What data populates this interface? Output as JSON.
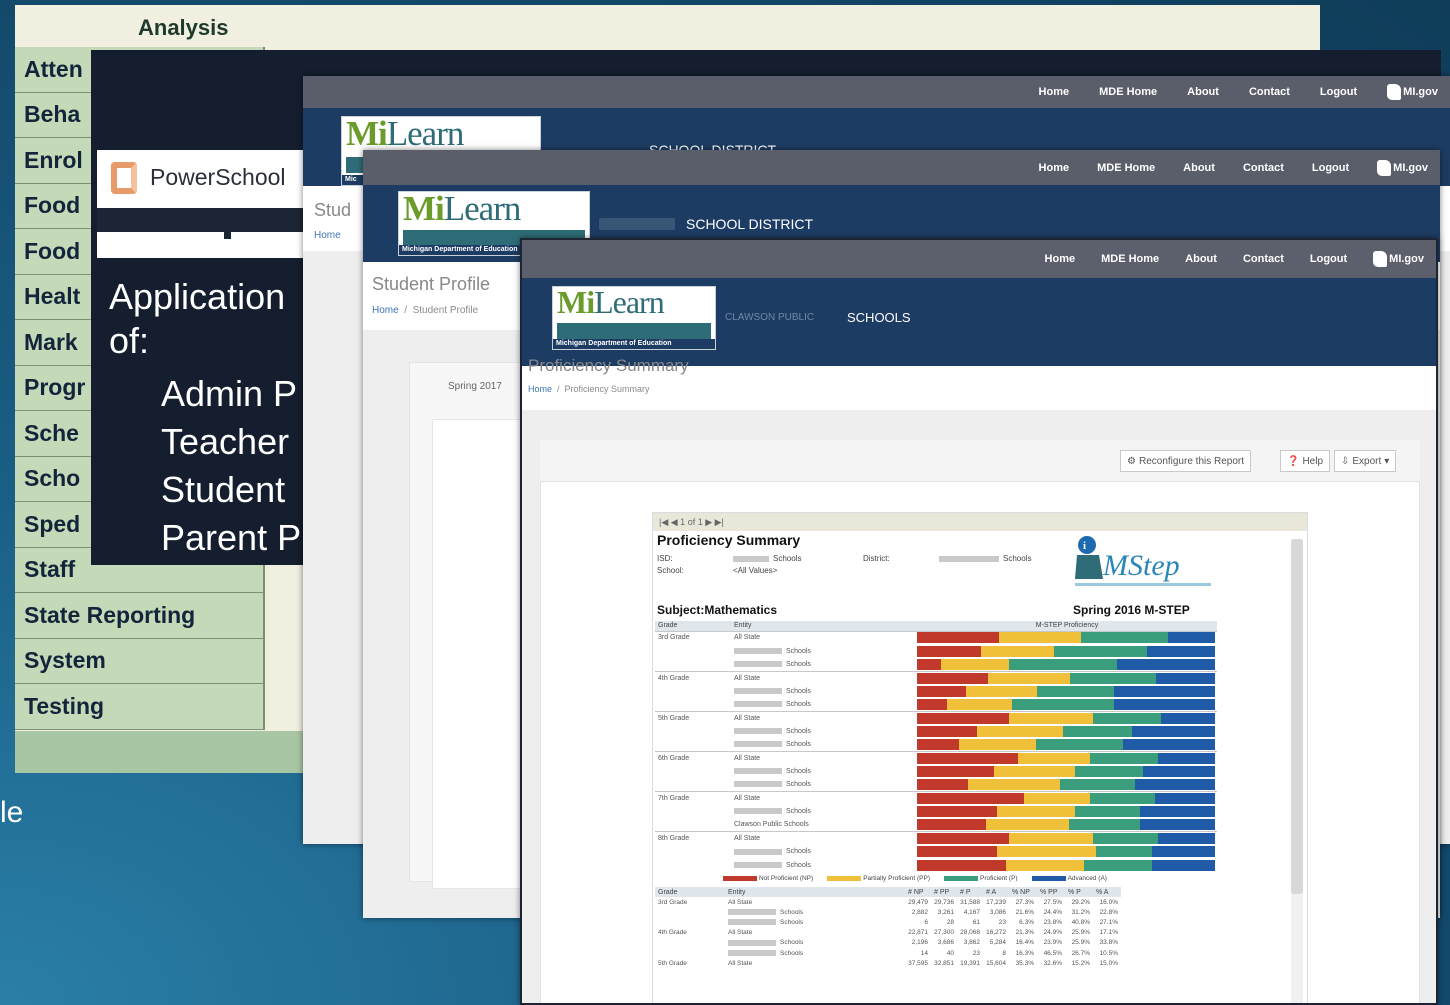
{
  "menu": {
    "title": "Analysis",
    "items": [
      "Atten",
      "Beha",
      "Enrol",
      "Food",
      "Food",
      "Healt",
      "Mark",
      "Progr",
      "Sche",
      "Scho",
      "Sped",
      "Staff",
      "State Reporting",
      "System",
      "Testing"
    ]
  },
  "background_text": "le",
  "powerschool": {
    "logo_text": "PowerSchool",
    "heading_line1": "Application",
    "heading_line2": "of:",
    "bullets": [
      "Admin P",
      "Teacher",
      "Student",
      "Parent P"
    ]
  },
  "nav": {
    "home": "Home",
    "mde_home": "MDE Home",
    "about": "About",
    "contact": "Contact",
    "logout": "Logout",
    "migov": "MI.gov"
  },
  "milearn": {
    "logo_prefix": "Mi",
    "logo_word": "Learn",
    "logo_footer": "Michigan Department of Education",
    "logo_footer_short": "Mic"
  },
  "win1": {
    "district": "SCHOOL DISTRICT",
    "page_title": "Stud",
    "breadcrumb_home": "Home"
  },
  "win2": {
    "district": "SCHOOL DISTRICT",
    "page_title": "Student Profile",
    "breadcrumb_home": "Home",
    "breadcrumb_current": "Student Profile",
    "tab_label": "Spring 2017"
  },
  "win3": {
    "district": "SCHOOLS",
    "district_prefix": "CLAWSON PUBLIC",
    "page_title": "Proficiency Summary",
    "breadcrumb_home": "Home",
    "breadcrumb_current": "Proficiency Summary",
    "toolbar": {
      "reconfigure": "Reconfigure this Report",
      "help": "Help",
      "export": "Export"
    }
  },
  "report": {
    "toolbar_text": "|◀  ◀  1  of 1  ▶  ▶|",
    "title": "Proficiency Summary",
    "isd_label": "ISD:",
    "isd_value": "Schools",
    "school_label": "School:",
    "school_value": "<All Values>",
    "district_label": "District:",
    "district_value": "Schools",
    "subject": "Subject:Mathematics",
    "assessment": "Spring 2016 M-STEP",
    "mstep_logo": "MStep",
    "table_headers": {
      "grade": "Grade",
      "entity": "Entity",
      "proficiency": "M-STEP Proficiency"
    },
    "legend": {
      "np": "Not Proficient (NP)",
      "pp": "Partially Proficient (PP)",
      "p": "Proficient (P)",
      "a": "Advanced (A)"
    },
    "num_headers": [
      "Grade",
      "Entity",
      "# NP",
      "# PP",
      "# P",
      "# A",
      "% NP",
      "% PP",
      "% P",
      "% A"
    ]
  },
  "chart_data": {
    "type": "bar",
    "title": "Proficiency Summary",
    "subtitle": "Subject:Mathematics — Spring 2016 M-STEP",
    "categories": [
      "3rd Grade – All State",
      "3rd Grade – Schools",
      "3rd Grade – Schools (Public)",
      "4th Grade – All State",
      "4th Grade – Schools",
      "4th Grade – Schools (Public)",
      "5th Grade – All State",
      "5th Grade – Schools",
      "5th Grade – Schools (Public)",
      "6th Grade – All State",
      "6th Grade – Schools",
      "6th Grade – Schools (Public)",
      "7th Grade – All State",
      "7th Grade – Schools",
      "7th Grade – Clawson Public Schools",
      "8th Grade – All State",
      "8th Grade – Schools",
      "8th Grade – Schools (Public)"
    ],
    "rows": [
      {
        "grade": "3rd Grade",
        "entity": "All State",
        "blur": false
      },
      {
        "grade": "",
        "entity": "Schools",
        "blur": true
      },
      {
        "grade": "",
        "entity": "Schools",
        "blur": true
      },
      {
        "grade": "4th Grade",
        "entity": "All State",
        "blur": false
      },
      {
        "grade": "",
        "entity": "Schools",
        "blur": true
      },
      {
        "grade": "",
        "entity": "Schools",
        "blur": true
      },
      {
        "grade": "5th Grade",
        "entity": "All State",
        "blur": false
      },
      {
        "grade": "",
        "entity": "Schools",
        "blur": true
      },
      {
        "grade": "",
        "entity": "Schools",
        "blur": true
      },
      {
        "grade": "6th Grade",
        "entity": "All State",
        "blur": false
      },
      {
        "grade": "",
        "entity": "Schools",
        "blur": true
      },
      {
        "grade": "",
        "entity": "Schools",
        "blur": true
      },
      {
        "grade": "7th Grade",
        "entity": "All State",
        "blur": false
      },
      {
        "grade": "",
        "entity": "Schools",
        "blur": true
      },
      {
        "grade": "",
        "entity": "Clawson Public Schools",
        "blur": false
      },
      {
        "grade": "8th Grade",
        "entity": "All State",
        "blur": false
      },
      {
        "grade": "",
        "entity": "Schools",
        "blur": true
      },
      {
        "grade": "",
        "entity": "Schools",
        "blur": true
      }
    ],
    "series": [
      {
        "name": "Not Proficient (NP)",
        "color": "#c0392b",
        "values": [
          27.5,
          21.6,
          8.0,
          21.3,
          16.4,
          10.0,
          31.0,
          20.0,
          14.0,
          34.0,
          26.0,
          17.0,
          36.0,
          27.0,
          23.0,
          31.0,
          27.0,
          30.0
        ]
      },
      {
        "name": "Partially Proficient (PP)",
        "color": "#f0c03a",
        "values": [
          27.5,
          24.4,
          23.0,
          24.9,
          23.9,
          22.0,
          28.0,
          29.0,
          26.0,
          24.0,
          27.0,
          31.0,
          22.0,
          26.0,
          28.0,
          28.0,
          33.0,
          26.0
        ]
      },
      {
        "name": "Proficient (P)",
        "color": "#3a9e7c",
        "values": [
          29.2,
          31.2,
          36.0,
          25.9,
          25.9,
          34.0,
          23.0,
          23.0,
          29.0,
          23.0,
          23.0,
          25.0,
          22.0,
          22.0,
          24.0,
          22.0,
          19.0,
          23.0
        ]
      },
      {
        "name": "Advanced (A)",
        "color": "#1f5ba6",
        "values": [
          15.8,
          22.8,
          33.0,
          17.9,
          33.8,
          34.0,
          18.0,
          28.0,
          31.0,
          19.0,
          24.0,
          27.0,
          20.0,
          25.0,
          25.0,
          19.0,
          21.0,
          21.0
        ]
      }
    ],
    "xlabel": "",
    "ylabel": "",
    "xlim": [
      0,
      100
    ],
    "legend": "bottom"
  },
  "num_rows": [
    {
      "grade": "3rd Grade",
      "entity": "All State",
      "blur": false,
      "vals": [
        "29,479",
        "29,736",
        "31,588",
        "17,239",
        "27.3%",
        "27.5%",
        "29.2%",
        "16.0%"
      ]
    },
    {
      "grade": "",
      "entity": "Schools",
      "blur": true,
      "vals": [
        "2,882",
        "3,261",
        "4,167",
        "3,086",
        "21.6%",
        "24.4%",
        "31.2%",
        "22.8%"
      ]
    },
    {
      "grade": "",
      "entity": "Schools",
      "blur": true,
      "vals": [
        "6",
        "28",
        "61",
        "23",
        "6.3%",
        "23.8%",
        "40.8%",
        "27.1%"
      ]
    },
    {
      "grade": "4th Grade",
      "entity": "All State",
      "blur": false,
      "vals": [
        "22,871",
        "27,300",
        "28,068",
        "16,272",
        "21.3%",
        "24.9%",
        "25.9%",
        "17.1%"
      ]
    },
    {
      "grade": "",
      "entity": "Schools",
      "blur": true,
      "vals": [
        "2,196",
        "3,686",
        "3,862",
        "5,284",
        "16.4%",
        "23.9%",
        "25.9%",
        "33.8%"
      ]
    },
    {
      "grade": "",
      "entity": "Schools",
      "blur": true,
      "vals": [
        "14",
        "40",
        "23",
        "8",
        "16.3%",
        "46.5%",
        "26.7%",
        "10.5%"
      ]
    },
    {
      "grade": "5th Grade",
      "entity": "All State",
      "blur": false,
      "vals": [
        "37,595",
        "32,851",
        "19,391",
        "15,604",
        "35.3%",
        "32.6%",
        "15.2%",
        "15.0%"
      ]
    }
  ]
}
